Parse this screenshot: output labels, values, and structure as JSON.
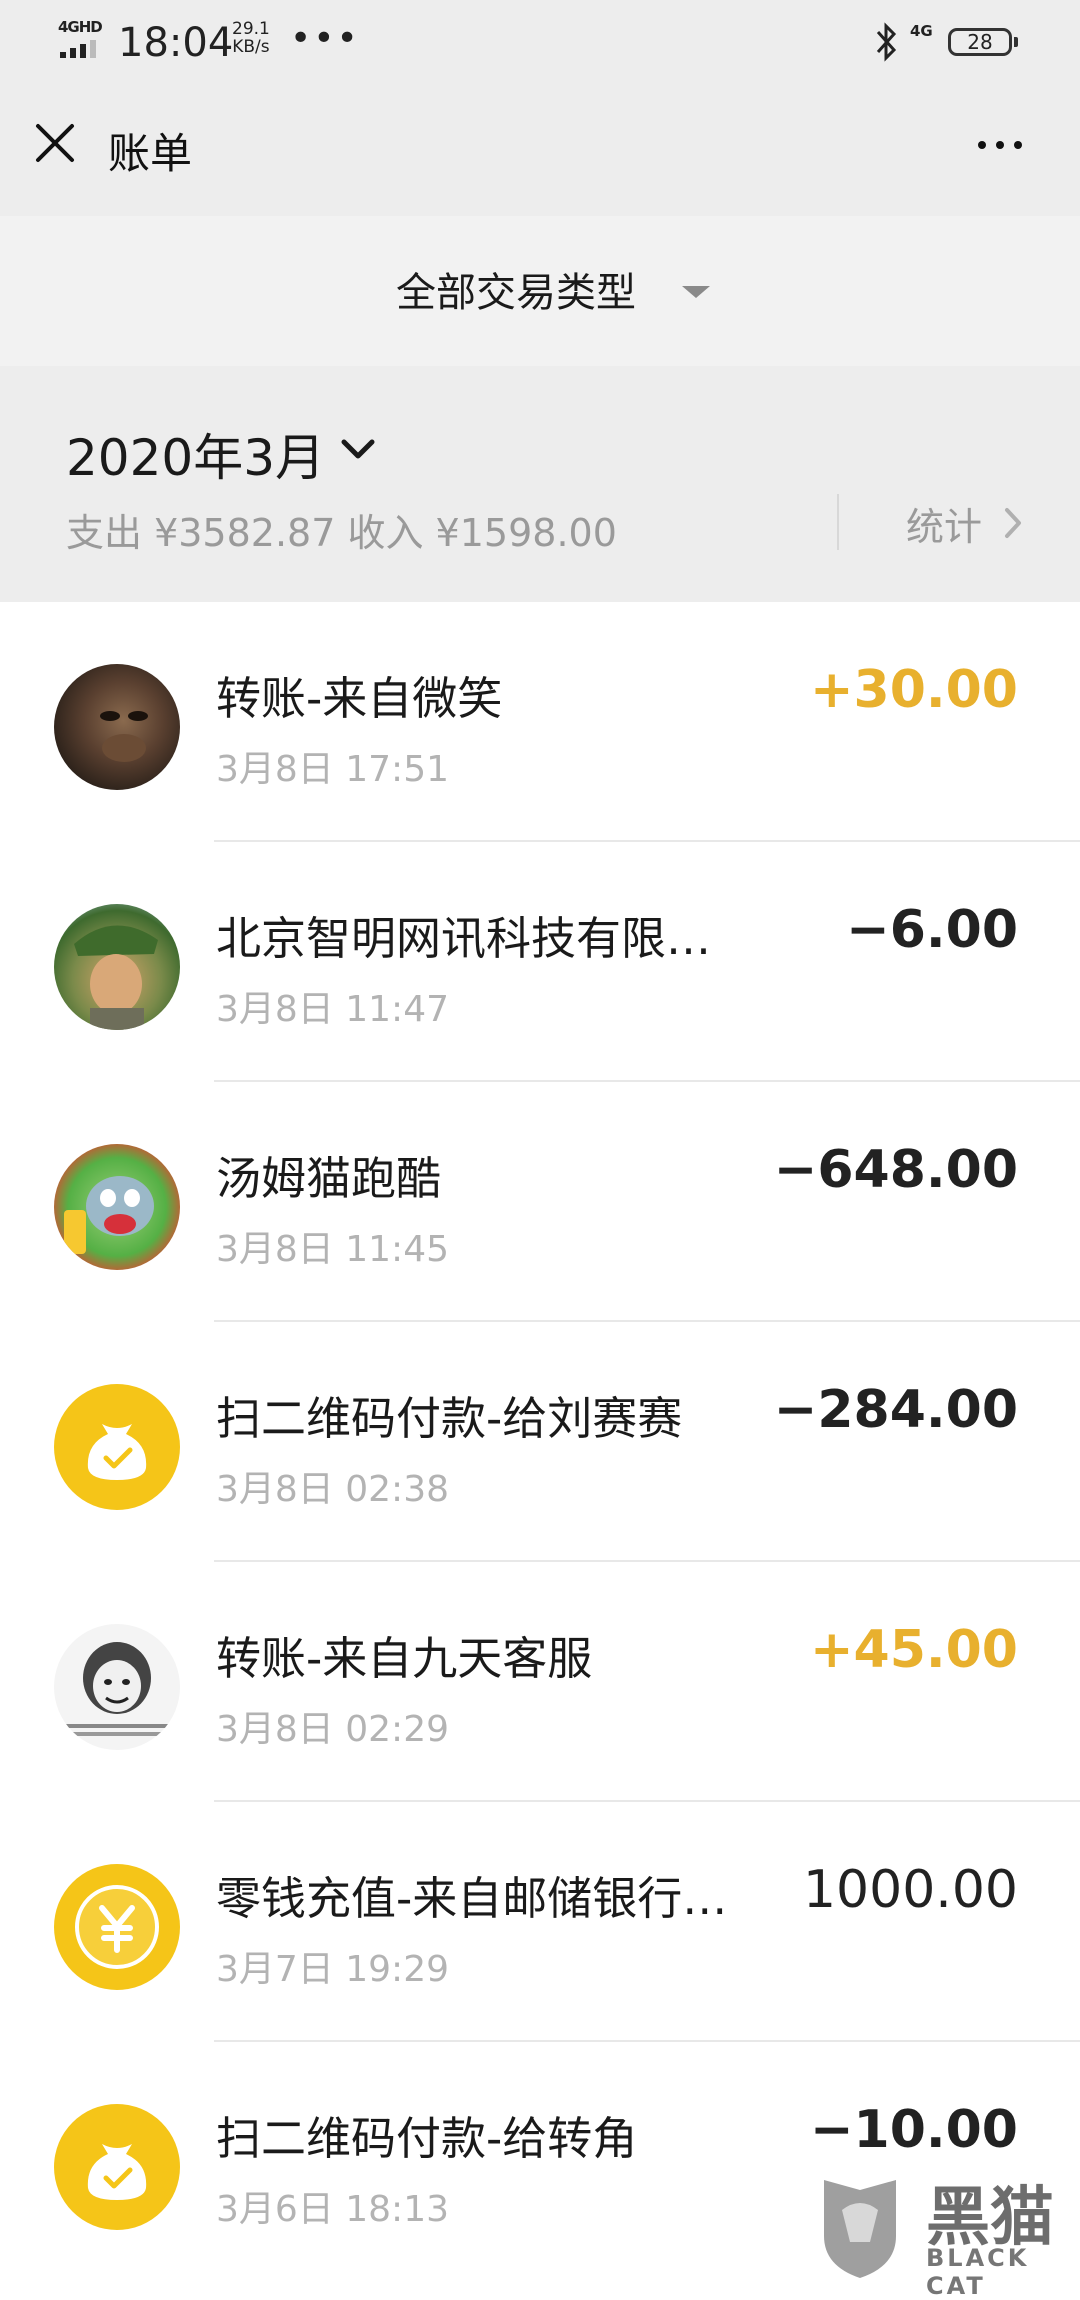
{
  "status_bar": {
    "network": "4GHD",
    "time": "18:04",
    "speed_value": "29.1",
    "speed_unit": "KB/s",
    "overflow": "•••",
    "signal_type": "4G",
    "battery": "28"
  },
  "header": {
    "title": "账单"
  },
  "filter": {
    "label": "全部交易类型"
  },
  "summary": {
    "month": "2020年3月",
    "totals": "支出 ¥3582.87 收入 ¥1598.00",
    "stats_label": "统计"
  },
  "transactions": [
    {
      "title": "转账-来自微笑",
      "time": "3月8日 17:51",
      "amount": "+30.00",
      "kind": "income",
      "avatar": "gorilla-avatar"
    },
    {
      "title": "北京智明网讯科技有限…",
      "time": "3月8日 11:47",
      "amount": "−6.00",
      "kind": "expense",
      "avatar": "soldier-avatar"
    },
    {
      "title": "汤姆猫跑酷",
      "time": "3月8日 11:45",
      "amount": "−648.00",
      "kind": "expense",
      "avatar": "cat-avatar"
    },
    {
      "title": "扫二维码付款-给刘赛赛",
      "time": "3月8日 02:38",
      "amount": "−284.00",
      "kind": "expense",
      "avatar": "money-bag-icon"
    },
    {
      "title": "转账-来自九天客服",
      "time": "3月8日 02:29",
      "amount": "+45.00",
      "kind": "income",
      "avatar": "meme-avatar"
    },
    {
      "title": "零钱充值-来自邮储银行…",
      "time": "3月7日 19:29",
      "amount": "1000.00",
      "kind": "neutral",
      "avatar": "yuan-coin-icon"
    },
    {
      "title": "扫二维码付款-给转角",
      "time": "3月6日 18:13",
      "amount": "−10.00",
      "kind": "expense",
      "avatar": "money-bag-icon"
    }
  ],
  "watermark": {
    "text": "黑猫",
    "sub": "BLACK CAT"
  }
}
